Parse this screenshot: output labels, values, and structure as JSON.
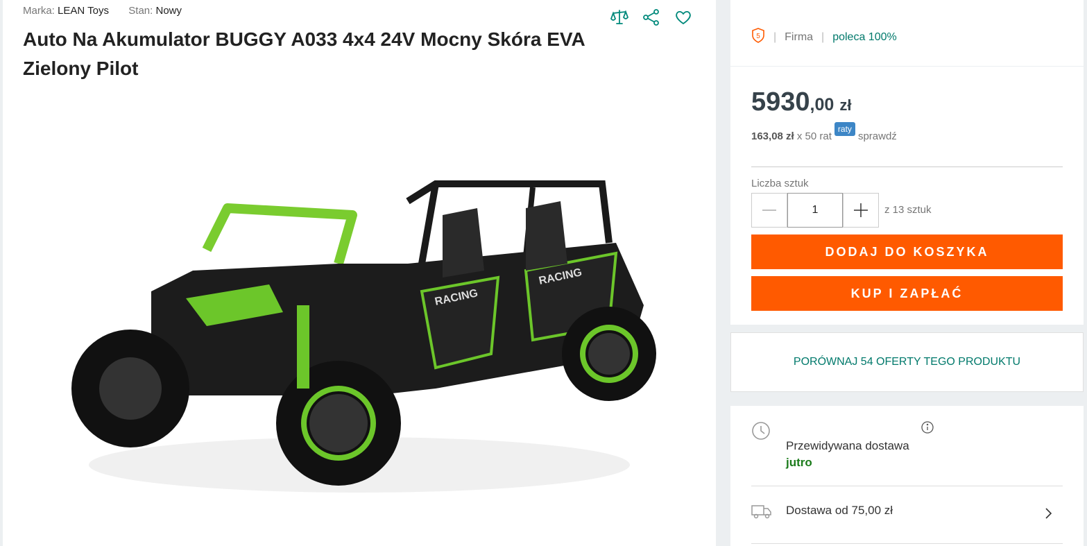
{
  "product": {
    "brand_label": "Marka:",
    "brand": "LEAN Toys",
    "condition_label": "Stan:",
    "condition": "Nowy",
    "title": "Auto Na Akumulator BUGGY A033 4x4 24V Mocny Skóra EVA Zielony Pilot",
    "image_desc": "green-black-electric-buggy"
  },
  "actions": {
    "compare_icon": "scales-icon",
    "share_icon": "share-icon",
    "favorite_icon": "heart-icon"
  },
  "seller": {
    "badge": "5",
    "type": "Firma",
    "recommend": "poleca 100%"
  },
  "price": {
    "integer": "5930",
    "decimal": ",00",
    "currency": "zł",
    "installment_amount": "163,08 zł",
    "installment_count": "x 50 rat",
    "raty_badge": "raty",
    "check": "sprawdź"
  },
  "quantity": {
    "label": "Liczba sztuk",
    "value": "1",
    "available": "z 13 sztuk"
  },
  "buttons": {
    "add_to_cart": "DODAJ DO KOSZYKA",
    "buy_now": "KUP I ZAPŁAĆ"
  },
  "compare": {
    "label": "PORÓWNAJ 54 OFERTY TEGO PRODUKTU"
  },
  "delivery": {
    "expected_label": "Przewidywana dostawa",
    "expected_when": "jutro",
    "cost": "Dostawa od 75,00 zł"
  },
  "colors": {
    "accent": "#ff5a00",
    "teal": "#00796b",
    "raty": "#3d86c6",
    "green_text": "#1b7b1b"
  }
}
